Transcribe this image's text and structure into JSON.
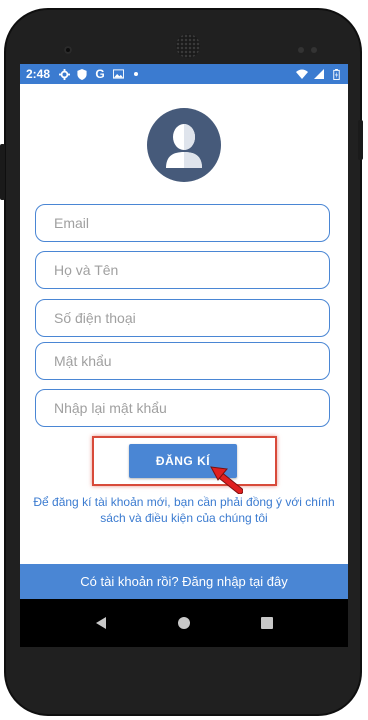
{
  "status_bar": {
    "time": "2:48",
    "icons_left": [
      "settings-icon",
      "shield-icon",
      "google-icon",
      "gallery-icon",
      "dot-icon"
    ],
    "icons_right": [
      "wifi-icon",
      "signal-icon",
      "battery-icon"
    ]
  },
  "form": {
    "email_placeholder": "Email",
    "name_placeholder": "Họ và Tên",
    "phone_placeholder": "Số điện thoại",
    "password_placeholder": "Mật khẩu",
    "confirm_password_placeholder": "Nhập lại mật khẩu"
  },
  "register_button": {
    "label": "ĐĂNG KÍ"
  },
  "terms_text": "Để đăng kí tài khoản mới, bạn cần phải đồng ý với chính sách và điều kiện của chúng tôi",
  "login_link": "Có tài khoản rồi? Đăng nhập tại đây",
  "colors": {
    "primary": "#4a86d4",
    "status_bar": "#3b7bd0",
    "avatar_bg": "#465a7a",
    "highlight": "#d84a3a"
  }
}
